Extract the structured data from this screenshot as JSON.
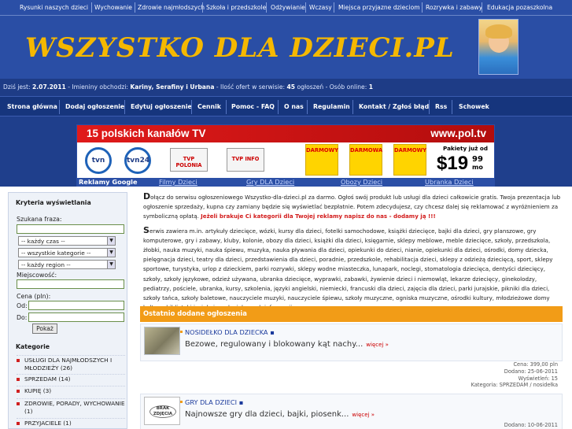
{
  "top_nav": [
    "Rysunki naszych dzieci",
    "Wychowanie",
    "Zdrowie najmłodszych",
    "Szkoła i przedszkole",
    "Odżywianie",
    "Wczasy",
    "Miejsca przyjazne dzieciom",
    "Rozrywka i zabawy",
    "Edukacja pozaszkolna"
  ],
  "logo": "WSZYSTKO DLA DZIECI.PL",
  "info": {
    "date_prefix": "Dziś jest:",
    "date": "2.07.2011",
    "names_prefix": " - Imieniny obchodzi:",
    "names": "Kariny, Serafiny i Urbana",
    "offers_prefix": " - Ilość ofert w serwisie:",
    "offers": "45",
    "offers_suffix": " ogłoszeń - Osób online:",
    "online": "1"
  },
  "main_menu": [
    "Strona główna",
    "Dodaj ogłoszenie",
    "Edytuj ogłoszenie",
    "Cennik",
    "Pomoc - FAQ",
    "O nas",
    "Regulamin",
    "Kontakt / Zgłoś błąd",
    "Rss",
    "Schowek"
  ],
  "banner": {
    "headline": "15 polskich kanałów TV",
    "site": "www.pol.tv",
    "ch1": "tvn",
    "ch2": "tvn24",
    "ch3": "TVP POLONIA",
    "ch4": "TVP INFO",
    "promo1": "DARMOWY",
    "promo2": "DARMOWA",
    "promo3": "DARMOWY",
    "pak": "Pakiety już od",
    "price": "$19",
    "cents": "99",
    "mo": "mo"
  },
  "ads_bar": {
    "title": "Reklamy Google",
    "links": [
      "Filmy Dzieci",
      "Gry DLA Dzieci",
      "Obozy Dzieci",
      "Ubranka Dzieci"
    ]
  },
  "sidebar": {
    "title": "Kryteria wyświetlania",
    "phrase_label": "Szukana fraza:",
    "time_select": "-- każdy czas --",
    "category_select": "-- wszystkie kategorie --",
    "region_select": "-- każdy region --",
    "city_label": "Miejscowość:",
    "price_label": "Cena (pln):",
    "from_label": "Od:",
    "to_label": "Do:",
    "search_button": "Pokaż",
    "categories_title": "Kategorie",
    "categories": [
      "USŁUGI DLA NAJMŁODSZYCH I MŁODZIEŻY (26)",
      "SPRZEDAM (14)",
      "KUPIĘ (3)",
      "ZDROWIE, PORADY, WYCHOWANIE (1)",
      "PRZYJACIELE (1)"
    ]
  },
  "intro": {
    "p1_drop": "D",
    "p1_text": "ołącz do serwisu ogłoszeniowego Wszystko-dla-dzieci.pl za darmo. Ogłoś swój produkt lub usługi dla dzieci całkowicie gratis. Twoja prezentacja lub ogłoszenie sprzedaży, kupna czy zamiany będzie się wyświetlać bezpłatnie. Potem zdecydujesz, czy chcesz dalej się reklamować z wyróżnieniem za symboliczną opłatą.",
    "p1_red": "Jeżeli brakuje Ci kategorii dla Twojej reklamy napisz do nas - dodamy ją !!!",
    "p2_drop": "S",
    "p2_text": "erwis zawiera m.in. artykuły dziecięce, wózki, kursy dla dzieci, fotelki samochodowe, książki dziecięce, bajki dla dzieci, gry planszowe, gry komputerowe, gry i zabawy, kluby, kolonie, obozy dla dzieci, książki dla dzieci, księgarnie, sklepy meblowe, meble dziecięce, szkoły, przedszkola, żłobki, nauka muzyki, nauka śpiewu, muzyka, nauka pływania dla dzieci, opiekunki do dzieci, nianie, opiekunki dla dzieci, ośrodki, domy dziecka, pielęgnacja dzieci, teatry dla dzieci, przedstawienia dla dzieci, poradnie, przedszkole, rehabilitacja dzieci, sklepy z odzieżą dziecięcą, sport, sklepy sportowe, turystyka, urlop z dzieckiem, parki rozrywki, sklepy wodne miasteczka, lunapark, noclegi, stomatologia dziecięca, dentyści dziecięcy, szkoły, szkoły językowe, odzież używana, ubranka dziecięce, wyprawki, zabawki, żywienie dzieci i niemowląt, lekarze dziecięcy, ginekolodzy, pediatrzy, pościele, ubranka, kursy, szkolenia, języki angielski, niemiecki, francuski dla dzieci, zajęcia dla dzieci, parki jurajskie, pikniki dla dzieci, szkoły tańca, szkoły baletowe, nauczyciele muzyki, nauczyciele śpiewu, szkoły muzyczne, ogniska muzyczne, ośrodki kultury, młodzieżowe domy kultury, biblioteki i wiele innych ciekawych informacji."
  },
  "section_title": "Ostatnio dodane ogłoszenia",
  "items": [
    {
      "title": "NOSIDEŁKO DLA DZIECKA",
      "desc": "Bezowe, regulowany i blokowany kąt nachy...",
      "more": "więcej »",
      "price": "Cena: 399,00 pln",
      "added": "Dodano: 25-06-2011",
      "views": "Wyświetleń: 15",
      "category": "Kategoria: SPRZEDAM / nosidełka"
    },
    {
      "title": "GRY DLA DZIECI",
      "desc": "Najnowsze gry dla dzieci, bajki, piosenk...",
      "more": "więcej »",
      "no_image": "BRAK ZDJĘCIA",
      "added": "Dodano: 10-06-2011"
    }
  ]
}
